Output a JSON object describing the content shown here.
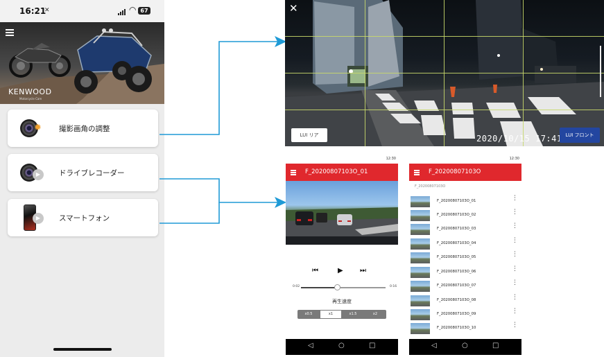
{
  "phone": {
    "status_time": "16:21",
    "battery": "67",
    "brand": "KENWOOD",
    "brand_sub": "Motorcycle Cam",
    "cards": [
      {
        "label": "撮影画角の調整",
        "icon": "lens-adjust-icon"
      },
      {
        "label": "ドライブレコーダー",
        "icon": "camera-play-icon"
      },
      {
        "label": "スマートフォン",
        "icon": "smartphone-play-icon"
      }
    ]
  },
  "camera_view": {
    "rear_button": "LUI リア",
    "front_button": "LUI フロント",
    "timestamp": "2020/10/15 17:41:"
  },
  "player": {
    "status_time": "12:30",
    "title": "F_20200807103O_01",
    "time_start": "0:02",
    "time_end": "0:16",
    "speed_label": "再生速度",
    "speeds": [
      "x0.5",
      "x1",
      "x1.5",
      "x2"
    ],
    "selected_speed": "x1"
  },
  "filelist": {
    "status_time": "12:30",
    "title": "F_20200807103O",
    "subtitle": "F_20200807103O",
    "files": [
      "F_20200807103O_01",
      "F_20200807103O_02",
      "F_20200807103O_03",
      "F_20200807103O_04",
      "F_20200807103O_05",
      "F_20200807103O_06",
      "F_20200807103O_07",
      "F_20200807103O_08",
      "F_20200807103O_09",
      "F_20200807103O_10"
    ]
  },
  "colors": {
    "accent_red": "#e0282d",
    "arrow_blue": "#1e9ad6",
    "front_button_blue": "#2346a0",
    "grid_line": "#c8d86a"
  }
}
